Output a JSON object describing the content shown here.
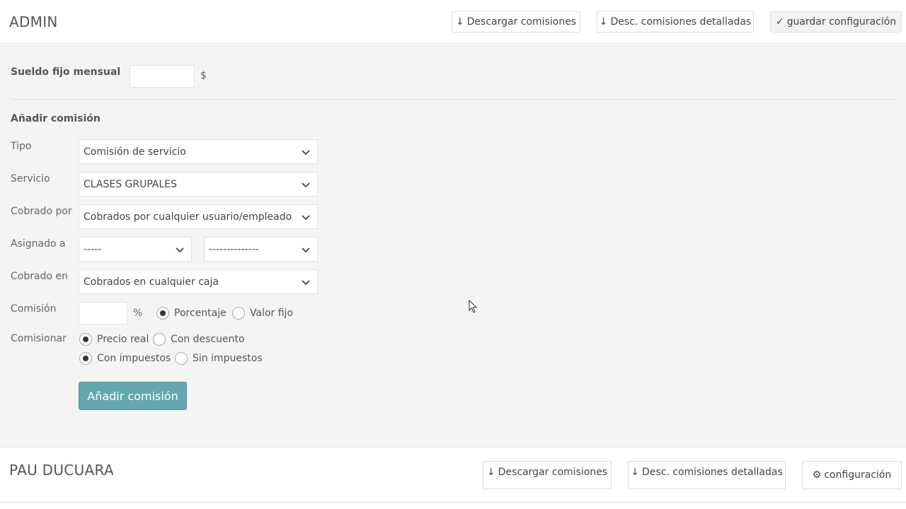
{
  "admin": {
    "name": "ADMIN",
    "buttons": {
      "download": "Descargar comisiones",
      "download_detailed": "Desc. comisiones detalladas",
      "save_config": "guardar configuración"
    }
  },
  "salary": {
    "label": "Sueldo fijo mensual",
    "value": "",
    "unit": "$"
  },
  "add_commission": {
    "title": "Añadir comisión",
    "tipo": {
      "label": "Tipo",
      "value": "Comisión de servicio"
    },
    "servicio": {
      "label": "Servicio",
      "value": "CLASES GRUPALES"
    },
    "cobrado_por": {
      "label": "Cobrado por",
      "value": "Cobrados por cualquier usuario/empleado"
    },
    "asignado_a": {
      "label": "Asignado a",
      "value1": "-----",
      "value2": "--------------"
    },
    "cobrado_en": {
      "label": "Cobrado en",
      "value": "Cobrados en cualquier caja"
    },
    "comision": {
      "label": "Comisión",
      "value": "",
      "unit": "%",
      "opt_percent": "Porcentaje",
      "opt_fixed": "Valor fijo"
    },
    "comisionar": {
      "label": "Comisionar",
      "opt_real": "Precio real",
      "opt_discount": "Con descuento",
      "opt_tax": "Con impuestos",
      "opt_notax": "Sin impuestos"
    },
    "submit": "Añadir comisión"
  },
  "user2": {
    "name": "PAU DUCUARA",
    "buttons": {
      "download": "Descargar comisiones",
      "download_detailed": "Desc. comisiones detalladas",
      "config": "configuración"
    }
  },
  "colors": {
    "accent": "#62a8ae",
    "panel_bg": "#f4f4f4"
  }
}
